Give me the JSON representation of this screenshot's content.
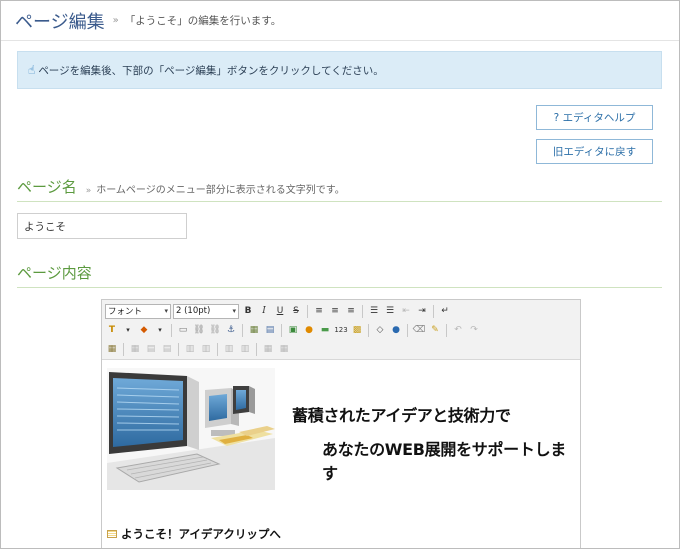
{
  "header": {
    "title": "ページ編集",
    "separator": "»",
    "subtitle": "「ようこそ」の編集を行います。"
  },
  "info": {
    "icon": "thumbs-up-icon",
    "text": "ページを編集後、下部の「ページ編集」ボタンをクリックしてください。"
  },
  "buttons": {
    "editor_help": "? エディタヘルプ",
    "old_editor": "旧エディタに戻す"
  },
  "page_name": {
    "heading": "ページ名",
    "separator": "»",
    "description": "ホームページのメニュー部分に表示される文字列です。",
    "value": "ようこそ"
  },
  "page_content": {
    "heading": "ページ内容"
  },
  "editor": {
    "font_select": "フォント",
    "size_select": "2 (10pt)",
    "toolbar_row1": [
      "bold-icon",
      "italic-icon",
      "underline-icon",
      "strikethrough-icon",
      "align-left-icon",
      "align-center-icon",
      "align-right-icon",
      "bullet-list-icon",
      "numbered-list-icon",
      "outdent-icon",
      "indent-icon",
      "line-break-icon"
    ],
    "toolbar_row2": [
      "text-color-icon",
      "bg-color-icon",
      "hr-icon",
      "link-icon",
      "unlink-icon",
      "anchor-icon",
      "table-icon",
      "form-icon",
      "image-icon",
      "media-icon",
      "divider-icon",
      "counter-icon",
      "gallery-icon",
      "source-icon",
      "globe-icon",
      "eraser-icon",
      "clean-icon",
      "undo-icon",
      "redo-icon"
    ],
    "toolbar_row3": [
      "table-props-icon",
      "cell-props-icon",
      "row-insert-icon",
      "row-delete-icon",
      "col-insert-icon",
      "col-delete-icon",
      "merge-icon",
      "split-icon"
    ],
    "slogan_line1": "蓄積されたアイデアと技術力で",
    "slogan_line2": "あなたのWEB展開をサポートします",
    "welcome_heading": "ようこそ！アイデアクリップへ"
  },
  "colors": {
    "title_blue": "#3a5a8c",
    "section_green": "#5c9a3f",
    "info_bg": "#dbecf7",
    "button_border": "#8fb8d8"
  }
}
